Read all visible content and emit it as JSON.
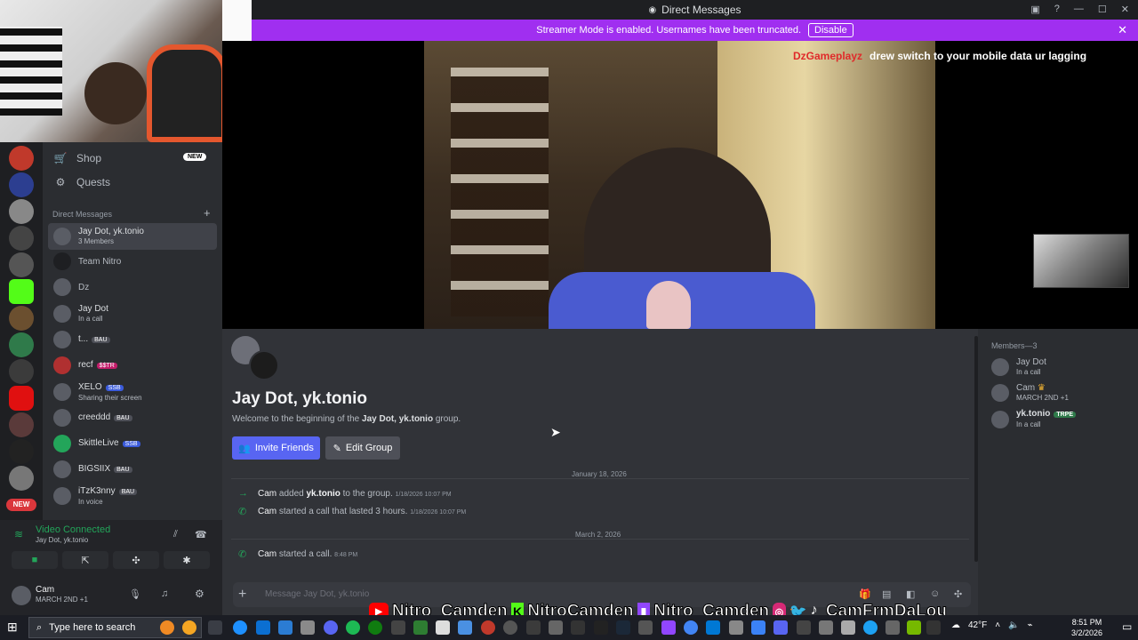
{
  "window": {
    "title": "Direct Messages"
  },
  "streamer_bar": {
    "text": "Streamer Mode is enabled. Usernames have been truncated.",
    "disable_label": "Disable"
  },
  "overlay": {
    "username": "DzGameplayz",
    "message": "drew switch to your mobile data ur lagging"
  },
  "nav": {
    "shop": "Shop",
    "shop_badge": "NEW",
    "quests": "Quests"
  },
  "dm": {
    "header": "Direct Messages",
    "items": [
      {
        "name": "Jay Dot, yk.tonio",
        "sub": "3 Members",
        "tag": ""
      },
      {
        "name": "Team Nitro",
        "sub": "",
        "tag": ""
      },
      {
        "name": "Dz",
        "sub": "",
        "tag": ""
      },
      {
        "name": "Jay Dot",
        "sub": "In a call",
        "tag": ""
      },
      {
        "name": "t...",
        "sub": "",
        "tag": "BAU"
      },
      {
        "name": "recf",
        "sub": "",
        "tag": "$$TR"
      },
      {
        "name": "XELO",
        "sub": "Sharing their screen",
        "tag": "SSB"
      },
      {
        "name": "creeddd",
        "sub": "",
        "tag": "BAU"
      },
      {
        "name": "SkittleLive",
        "sub": "",
        "tag": "SSB"
      },
      {
        "name": "BIGSIIX",
        "sub": "",
        "tag": "BAU"
      },
      {
        "name": "iTzK3nny",
        "sub": "In voice",
        "tag": "BAU"
      }
    ]
  },
  "server_rail": {
    "new_label": "NEW"
  },
  "voice": {
    "title": "Video Connected",
    "sub": "Jay Dot, yk.tonio"
  },
  "user": {
    "name": "Cam",
    "status": "MARCH 2ND +1"
  },
  "chat": {
    "title": "Jay Dot, yk.tonio",
    "welcome_pre": "Welcome to the beginning of the ",
    "welcome_name": "Jay Dot, yk.tonio",
    "welcome_post": " group.",
    "invite_label": "Invite Friends",
    "edit_label": "Edit Group",
    "date1": "January 18, 2026",
    "date2": "March 2, 2026",
    "messages": [
      {
        "who": "Cam",
        "text_pre": "added ",
        "target": "yk.tonio",
        "text_post": " to the group.",
        "ts": "1/18/2026 10:07 PM"
      },
      {
        "who": "Cam",
        "text_pre": "started a call that lasted 3 hours.",
        "target": "",
        "text_post": "",
        "ts": "1/18/2026 10:07 PM"
      },
      {
        "who": "Cam",
        "text_pre": "started a call.",
        "target": "",
        "text_post": "",
        "ts": "8:48 PM"
      }
    ],
    "input_placeholder": "Message Jay Dot, yk.tonio"
  },
  "members": {
    "title": "Members—3",
    "items": [
      {
        "name": "Jay Dot",
        "sub": "In a call",
        "tag": ""
      },
      {
        "name": "Cam",
        "sub": "MARCH 2ND +1",
        "tag": ""
      },
      {
        "name": "yk.tonio",
        "sub": "In a call",
        "tag": "TRPE"
      }
    ]
  },
  "banner": {
    "youtube": "Nitro_Camden",
    "kick": "NitroCamden",
    "twitch": "Nitro_Camden",
    "social": "CamFrmDaLou"
  },
  "taskbar": {
    "search_placeholder": "Type here to search",
    "temp": "42°F",
    "time": "8:51 PM",
    "date": "3/2/2026"
  },
  "colors": {
    "accent": "#5865f2",
    "streamer": "#a02ff0",
    "online": "#23a55a",
    "overlay_user": "#e02a2a"
  }
}
